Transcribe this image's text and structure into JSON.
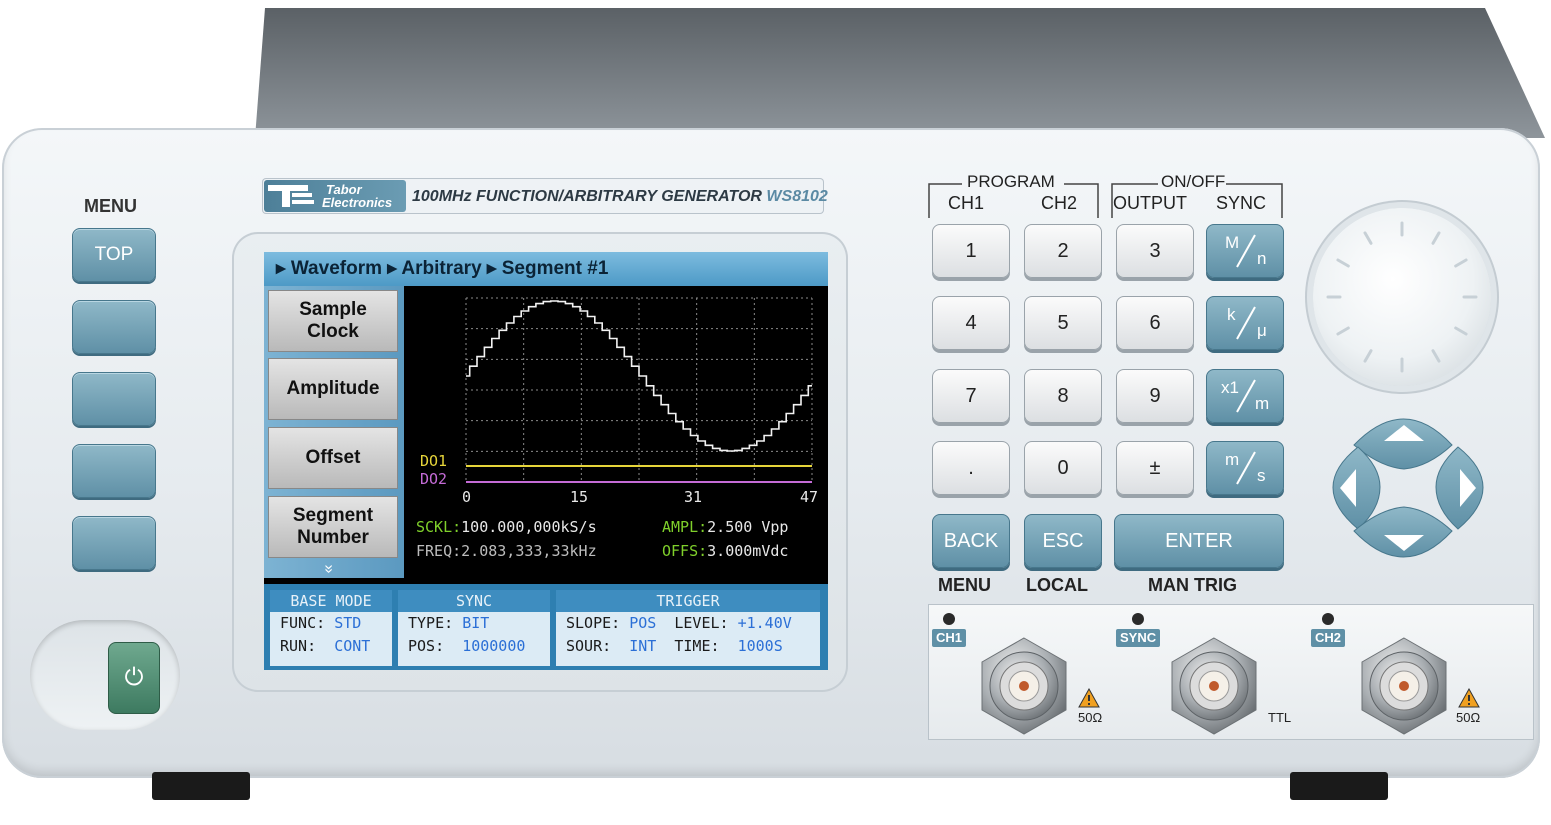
{
  "menu_label": "MENU",
  "menu_top_key": "TOP",
  "power_symbol": "⏻",
  "brand": {
    "line1": "Tabor",
    "line2": "Electronics"
  },
  "product_title": "100MHz FUNCTION/ARBITRARY GENERATOR",
  "model": "WS8102",
  "screen": {
    "breadcrumb": {
      "b1": "Waveform",
      "b2": "Arbitrary",
      "b3": "Segment #1"
    },
    "softkeys": {
      "sample_clock": {
        "l1": "Sample",
        "l2": "Clock"
      },
      "amplitude": "Amplitude",
      "offset": "Offset",
      "segment_number": {
        "l1": "Segment",
        "l2": "Number"
      },
      "more": "»"
    },
    "digital_labels": {
      "do1": "DO1",
      "do2": "DO2"
    },
    "x_ticks": [
      "0",
      "15",
      "31",
      "47"
    ],
    "readouts": {
      "sckl_label": "SCKL:",
      "sckl_value": "100.000,000kS/s",
      "ampl_label": "AMPL:",
      "ampl_value": "2.500 Vpp",
      "freq_label": "FREQ:",
      "freq_value": "2.083,333,33kHz",
      "offs_label": "OFFS:",
      "offs_value": "3.000mVdc"
    },
    "status": {
      "base": {
        "title": "BASE MODE",
        "func_label": "FUNC:",
        "func_value": "STD",
        "run_label": "RUN:",
        "run_value": "CONT"
      },
      "sync": {
        "title": "SYNC",
        "type_label": "TYPE:",
        "type_value": "BIT",
        "pos_label": "POS:",
        "pos_value": "1000000"
      },
      "trigger": {
        "title": "TRIGGER",
        "slope_label": "SLOPE:",
        "slope_value": "POS",
        "level_label": "LEVEL:",
        "level_value": "+1.40V",
        "sour_label": "SOUR:",
        "sour_value": "INT",
        "time_label": "TIME:",
        "time_value": "1000S"
      }
    }
  },
  "keypad": {
    "program_label": "PROGRAM",
    "onoff_label": "ON/OFF",
    "ch1": "CH1",
    "ch2": "CH2",
    "output": "OUTPUT",
    "sync": "SYNC",
    "digits": {
      "k1": "1",
      "k2": "2",
      "k3": "3",
      "k4": "4",
      "k5": "5",
      "k6": "6",
      "k7": "7",
      "k8": "8",
      "k9": "9",
      "dot": ".",
      "k0": "0",
      "pm": "±"
    },
    "units": {
      "mn_top": "M",
      "mn_bot": "n",
      "ku_top": "k",
      "ku_bot": "μ",
      "xm_top": "x1",
      "xm_bot": "m",
      "ms_top": "m",
      "ms_bot": "s"
    },
    "back": "BACK",
    "esc": "ESC",
    "enter": "ENTER",
    "back_sub": "MENU",
    "esc_sub": "LOCAL",
    "enter_sub": "MAN TRIG"
  },
  "connectors": {
    "ch1": "CH1",
    "sync": "SYNC",
    "ch2": "CH2",
    "ch1_imp": "50Ω",
    "sync_imp": "TTL",
    "ch2_imp": "50Ω"
  }
}
